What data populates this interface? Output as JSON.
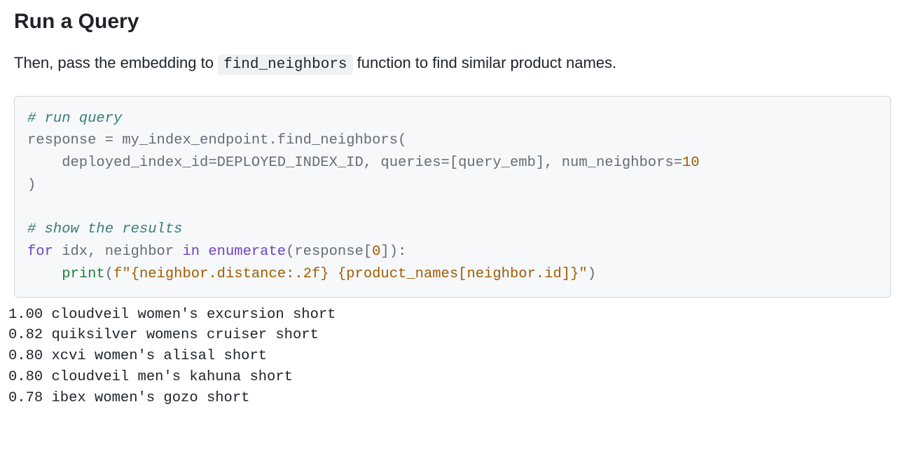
{
  "heading": "Run a Query",
  "intro": {
    "prefix": "Then, pass the embedding to ",
    "code": "find_neighbors",
    "suffix": " function to find similar product names."
  },
  "code": {
    "c1": "# run query",
    "l2a": "response ",
    "l2b": "=",
    "l2c": " my_index_endpoint",
    "l2d": ".",
    "l2e": "find_neighbors(",
    "l3a": "    deployed_index_id",
    "l3b": "=",
    "l3c": "DEPLOYED_INDEX_ID, queries",
    "l3d": "=",
    "l3e": "[query_emb], num_neighbors",
    "l3f": "=",
    "l3g": "10",
    "l4": ")",
    "blank": "",
    "c2": "# show the results",
    "l6a": "for",
    "l6b": " idx, neighbor ",
    "l6c": "in",
    "l6d": " ",
    "l6e": "enumerate",
    "l6f": "(response[",
    "l6g": "0",
    "l6h": "]):",
    "l7a": "    ",
    "l7b": "print",
    "l7c": "(",
    "l7d": "f\"",
    "l7e": "{neighbor.distance:.2f}",
    "l7f": " ",
    "l7g": "{product_names[neighbor.id]}",
    "l7h": "\"",
    "l7i": ")"
  },
  "output_lines": [
    "1.00 cloudveil women's excursion short",
    "0.82 quiksilver womens cruiser short",
    "0.80 xcvi women's alisal short",
    "0.80 cloudveil men's kahuna short",
    "0.78 ibex women's gozo short"
  ]
}
